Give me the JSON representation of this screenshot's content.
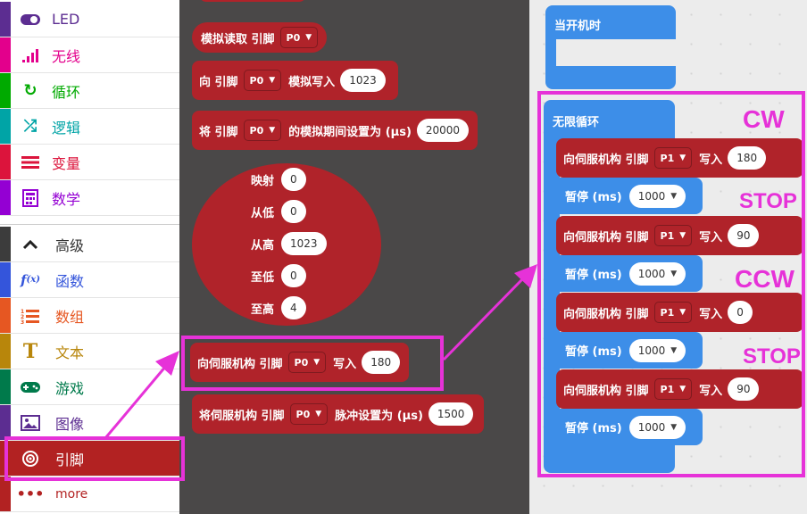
{
  "sidebar": {
    "categories": [
      {
        "label": "LED",
        "icon": "toggle-icon",
        "color": "#5c2d91"
      },
      {
        "label": "无线",
        "icon": "signal-bars-icon",
        "color": "#e3008c"
      },
      {
        "label": "循环",
        "icon": "refresh-icon",
        "color": "#00aa00"
      },
      {
        "label": "逻辑",
        "icon": "shuffle-icon",
        "color": "#00a4a6"
      },
      {
        "label": "变量",
        "icon": "list-lines-icon",
        "color": "#dc143c"
      },
      {
        "label": "数学",
        "icon": "calculator-icon",
        "color": "#9400d3"
      }
    ],
    "advanced": [
      {
        "label": "高级",
        "icon": "chevron-up-icon",
        "color": "#3c3c3c"
      },
      {
        "label": "函数",
        "icon": "function-icon",
        "color": "#3455db"
      },
      {
        "label": "数组",
        "icon": "numbered-list-icon",
        "color": "#e65722"
      },
      {
        "label": "文本",
        "icon": "text-t-icon",
        "color": "#b8860b"
      },
      {
        "label": "游戏",
        "icon": "gamepad-icon",
        "color": "#007a4b"
      },
      {
        "label": "图像",
        "icon": "image-icon",
        "color": "#5c2d91"
      },
      {
        "label": "引脚",
        "icon": "target-icon",
        "color": "#b22222"
      },
      {
        "label": "more",
        "icon": "dots-icon",
        "color": "#b22222"
      }
    ]
  },
  "palette": {
    "analog_read": {
      "label": "模拟读取 引脚",
      "pin": "P0"
    },
    "analog_write": {
      "prefix": "向 引脚",
      "pin": "P0",
      "action": "模拟写入",
      "value": "1023"
    },
    "analog_period": {
      "prefix": "将 引脚",
      "pin": "P0",
      "action": "的模拟期间设置为 (µs)",
      "value": "20000"
    },
    "map": {
      "rows": [
        {
          "label": "映射",
          "value": "0"
        },
        {
          "label": "从低",
          "value": "0"
        },
        {
          "label": "从高",
          "value": "1023"
        },
        {
          "label": "至低",
          "value": "0"
        },
        {
          "label": "至高",
          "value": "4"
        }
      ]
    },
    "servo_write": {
      "prefix": "向伺服机构 引脚",
      "pin": "P0",
      "action": "写入",
      "value": "180"
    },
    "servo_pulse": {
      "prefix": "将伺服机构 引脚",
      "pin": "P0",
      "action": "脉冲设置为 (µs)",
      "value": "1500"
    }
  },
  "canvas": {
    "on_start": "当开机时",
    "forever": "无限循环",
    "steps": [
      {
        "prefix": "向伺服机构 引脚",
        "pin": "P1",
        "action": "写入",
        "value": "180",
        "pause_label": "暂停 (ms)",
        "pause": "1000",
        "annotation": "CW"
      },
      {
        "prefix": "向伺服机构 引脚",
        "pin": "P1",
        "action": "写入",
        "value": "90",
        "pause_label": "暂停 (ms)",
        "pause": "1000",
        "annotation": "STOP"
      },
      {
        "prefix": "向伺服机构 引脚",
        "pin": "P1",
        "action": "写入",
        "value": "0",
        "pause_label": "暂停 (ms)",
        "pause": "1000",
        "annotation": "CCW"
      },
      {
        "prefix": "向伺服机构 引脚",
        "pin": "P1",
        "action": "写入",
        "value": "90",
        "pause_label": "暂停 (ms)",
        "pause": "1000",
        "annotation": "STOP"
      }
    ]
  },
  "colors": {
    "pins": "#b0232a",
    "loops": "#3d8ee8",
    "highlight": "#e632d8",
    "workspace": "#4a4848"
  }
}
